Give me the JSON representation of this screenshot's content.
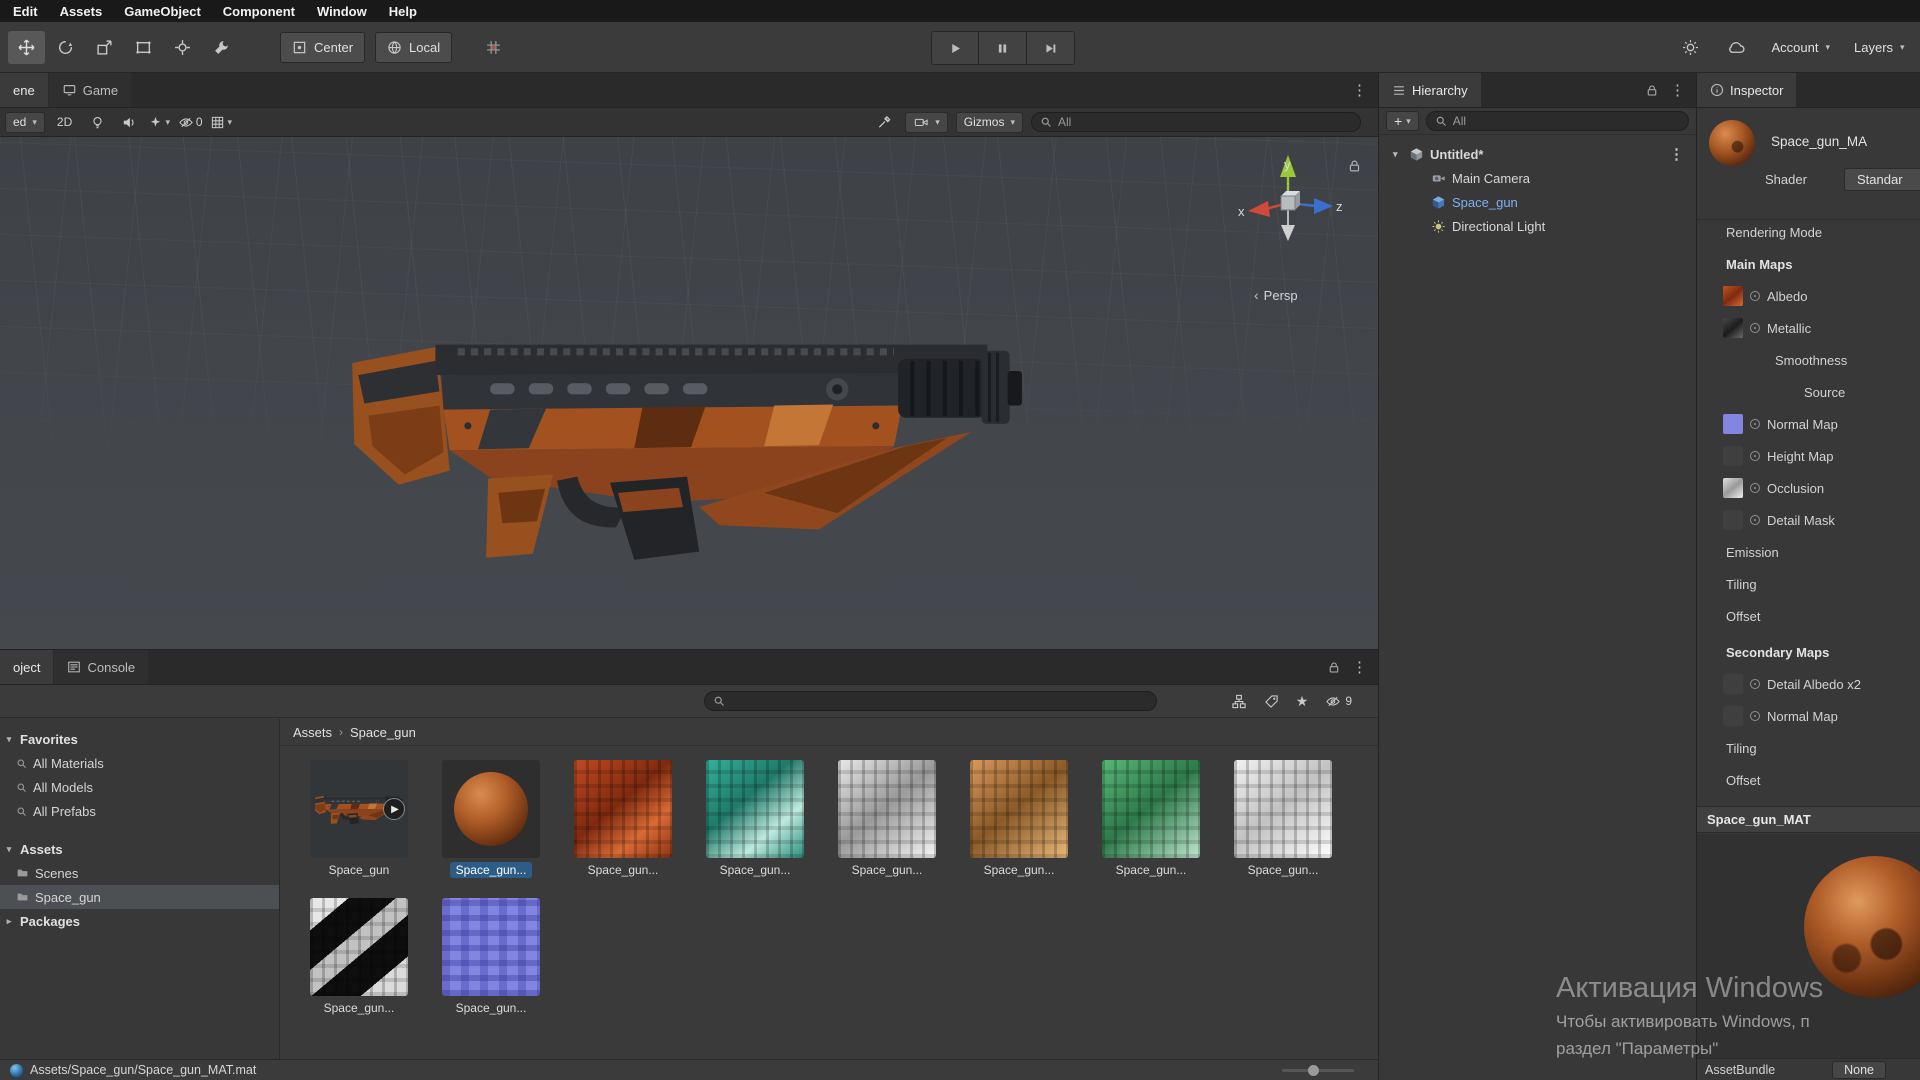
{
  "menu": {
    "items": [
      "Edit",
      "Assets",
      "GameObject",
      "Component",
      "Window",
      "Help"
    ]
  },
  "toolbar": {
    "center_label": "Center",
    "local_label": "Local",
    "account_label": "Account",
    "layers_label": "Layers"
  },
  "scene": {
    "tab_scene": "ene",
    "tab_game": "Game",
    "shading_dropdown": "ed",
    "mode_2d": "2D",
    "hidden_count": "0",
    "gizmos_label": "Gizmos",
    "search_text": "All",
    "persp_label": "Persp",
    "axis_x": "x",
    "axis_y": "y",
    "axis_z": "z"
  },
  "hierarchy": {
    "title": "Hierarchy",
    "search_text": "All",
    "scene_name": "Untitled*",
    "items": [
      {
        "label": "Main Camera"
      },
      {
        "label": "Space_gun"
      },
      {
        "label": "Directional Light"
      }
    ]
  },
  "project": {
    "tab_project": "oject",
    "tab_console": "Console",
    "sidebar": {
      "favorites_label": "Favorites",
      "favorites": [
        "All Materials",
        "All Models",
        "All Prefabs"
      ],
      "assets_label": "Assets",
      "folders": [
        "Scenes",
        "Space_gun"
      ],
      "packages_label": "Packages"
    },
    "breadcrumb": {
      "root": "Assets",
      "current": "Space_gun"
    },
    "hidden_count": "9",
    "items": [
      {
        "label": "Space_gun"
      },
      {
        "label": "Space_gun..."
      },
      {
        "label": "Space_gun..."
      },
      {
        "label": "Space_gun..."
      },
      {
        "label": "Space_gun..."
      },
      {
        "label": "Space_gun..."
      },
      {
        "label": "Space_gun..."
      },
      {
        "label": "Space_gun..."
      },
      {
        "label": "Space_gun..."
      },
      {
        "label": "Space_gun..."
      }
    ],
    "status_path": "Assets/Space_gun/Space_gun_MAT.mat"
  },
  "inspector": {
    "title": "Inspector",
    "material_name": "Space_gun_MA",
    "shader_label": "Shader",
    "shader_value": "Standar",
    "rows": {
      "rendering_mode": "Rendering Mode",
      "main_maps": "Main Maps",
      "albedo": "Albedo",
      "metallic": "Metallic",
      "smoothness": "Smoothness",
      "source": "Source",
      "normal_map": "Normal Map",
      "height_map": "Height Map",
      "occlusion": "Occlusion",
      "detail_mask": "Detail Mask",
      "emission": "Emission",
      "tiling": "Tiling",
      "offset": "Offset",
      "secondary_maps": "Secondary Maps",
      "detail_albedo": "Detail Albedo x2",
      "normal_map2": "Normal Map",
      "tiling2": "Tiling",
      "offset2": "Offset"
    },
    "preview_title": "Space_gun_MAT",
    "assetbundle_label": "AssetBundle",
    "assetbundle_value": "None"
  },
  "watermark": {
    "line1": "Активация Windows",
    "line2": "Чтобы активировать Windows, п",
    "line3": "раздел \"Параметры\""
  },
  "colors": {
    "selection_blue": "#2d5d87",
    "hierarchy_selected_text": "#7fb0f5",
    "accent_orange": "#a2511f"
  }
}
